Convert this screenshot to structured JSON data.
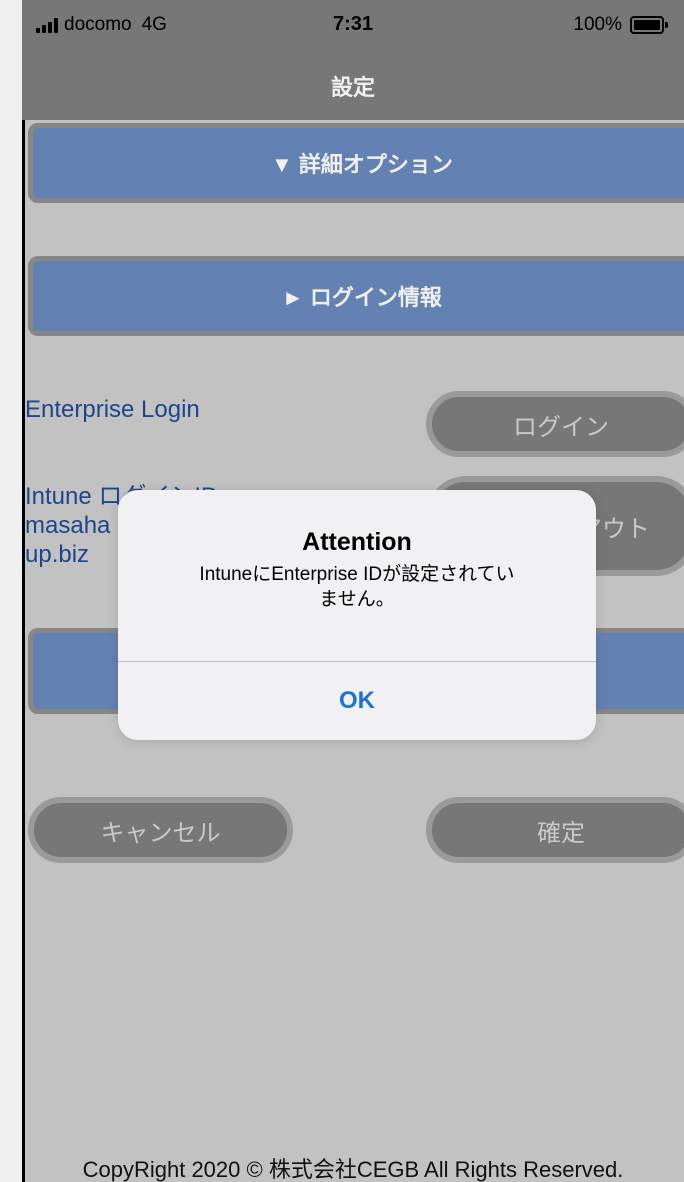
{
  "status_bar": {
    "carrier": "docomo",
    "network": "4G",
    "time": "7:31",
    "battery_percent": "100%"
  },
  "nav": {
    "title": "設定"
  },
  "sections": {
    "advanced_options": "▼ 詳細オプション",
    "login_info": "► ログイン情報"
  },
  "enterprise_login": {
    "label": "Enterprise Login",
    "button": "ログイン"
  },
  "intune": {
    "label_line1": "Intune ログインID",
    "id_line1": "masaha",
    "id_line2": "up.biz",
    "button": "アウト"
  },
  "actions": {
    "cancel": "キャンセル",
    "confirm": "確定"
  },
  "footer": {
    "copyright": "CopyRight 2020 © 株式会社CEGB All Rights Reserved."
  },
  "alert": {
    "title": "Attention",
    "message_line1": "IntuneにEnterprise IDが設定されてい",
    "message_line2": "ません。",
    "ok": "OK"
  },
  "colors": {
    "header_blue": "#6b8ac0",
    "nav_gray": "#7f7f7f",
    "link_blue": "#1f4a96",
    "alert_button": "#1a73d9"
  }
}
